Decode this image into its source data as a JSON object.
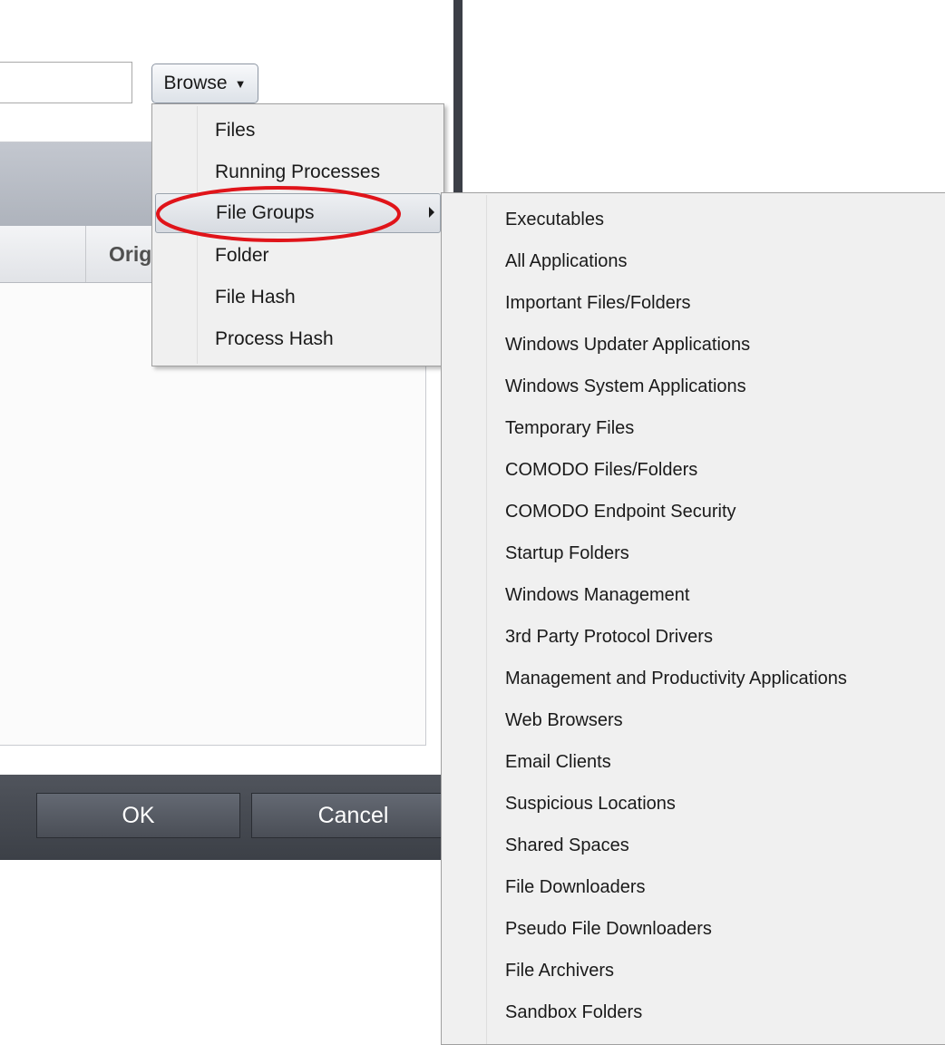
{
  "path_input": {
    "value": ""
  },
  "browse_button": {
    "label": "Browse",
    "caret": "▼"
  },
  "list": {
    "columns": [
      "Orig"
    ]
  },
  "footer": {
    "ok_label": "OK",
    "cancel_label": "Cancel"
  },
  "browse_menu": {
    "items": [
      {
        "label": "Files"
      },
      {
        "label": "Running Processes"
      },
      {
        "label": "File Groups",
        "has_submenu": true,
        "active": true
      },
      {
        "label": "Folder"
      },
      {
        "label": "File Hash"
      },
      {
        "label": "Process Hash"
      }
    ]
  },
  "file_groups_menu": {
    "items": [
      "Executables",
      "All Applications",
      "Important Files/Folders",
      "Windows Updater Applications",
      "Windows System Applications",
      "Temporary Files",
      "COMODO Files/Folders",
      "COMODO Endpoint Security",
      "Startup Folders",
      "Windows Management",
      "3rd Party Protocol Drivers",
      "Management and Productivity Applications",
      "Web Browsers",
      "Email Clients",
      "Suspicious Locations",
      "Shared Spaces",
      "File Downloaders",
      "Pseudo File Downloaders",
      "File Archivers",
      "Sandbox Folders"
    ]
  },
  "colors": {
    "highlight_ellipse": "#e0141a",
    "footer_bar": "#44484f",
    "menu_background": "#f0f0f0",
    "divider": "#3c3f47"
  }
}
